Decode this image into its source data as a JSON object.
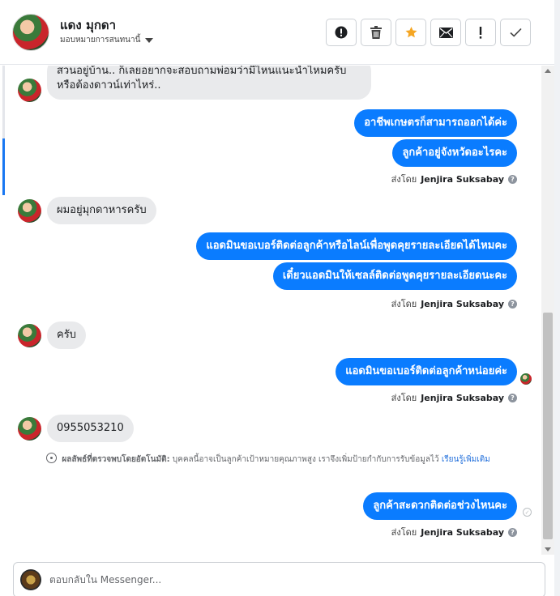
{
  "header": {
    "contact_name": "แดง มุกดา",
    "assignee_label": "มอบหมายการสนทนานี้",
    "toolbar": [
      {
        "icon": "alert-circle-icon",
        "glyph": "!",
        "name": "mark-spam-button"
      },
      {
        "icon": "trash-icon",
        "glyph": "🗑",
        "name": "delete-button"
      },
      {
        "icon": "star-icon",
        "glyph": "★",
        "name": "star-button"
      },
      {
        "icon": "envelope-icon",
        "glyph": "✉",
        "name": "mark-unread-button"
      },
      {
        "icon": "exclamation-icon",
        "glyph": "!",
        "name": "follow-up-button"
      },
      {
        "icon": "check-icon",
        "glyph": "✓",
        "name": "mark-done-button"
      }
    ]
  },
  "messages": {
    "m1": "สวนอยู่บ้าน.. ก็เลยอยากจะสอบถามพ่อมว่ามีไหนแนะนำไหมครับ หรือต้องดาวน์เท่าไหร่..",
    "m2": "อาชีพเกษตรก็สามารถออกได้ค่ะ",
    "m3": "ลูกค้าอยู่จังหวัดอะไรคะ",
    "m4": "ผมอยู่มุกดาหารครับ",
    "m5": "แอดมินขอเบอร์ติดต่อลูกค้าหรือไลน์เพื่อพูดคุยรายละเอียดได้ไหมคะ",
    "m6": "เดี๋ยวแอดมินให้เซลล์ติดต่อพูดคุยรายละเอียดนะคะ",
    "m7": "ครับ",
    "m8": "แอดมินขอเบอร์ติดต่อลูกค้าหน่อยค่ะ",
    "m9": "0955053210",
    "m10": "ลูกค้าสะดวกติดต่อช่วงไหนคะ"
  },
  "sent_by": {
    "prefix": "ส่งโดย",
    "agent": "Jenjira Suksabay",
    "help": "?"
  },
  "auto_note": {
    "label": "ผลลัพธ์ที่ตรวจพบโดยอัตโนมัติ:",
    "text": "บุคคลนี้อาจเป็นลูกค้าเป้าหมายคุณภาพสูง เราจึงเพิ่มป้ายกำกับการรับข้อมูลไว้",
    "link": "เรียนรู้เพิ่มเติม"
  },
  "composer": {
    "placeholder": "ตอบกลับใน Messenger..."
  },
  "colors": {
    "outgoing_bubble": "#0a7cff",
    "incoming_bubble": "#e9eaec",
    "star": "#f5a623",
    "link": "#216fdb"
  }
}
